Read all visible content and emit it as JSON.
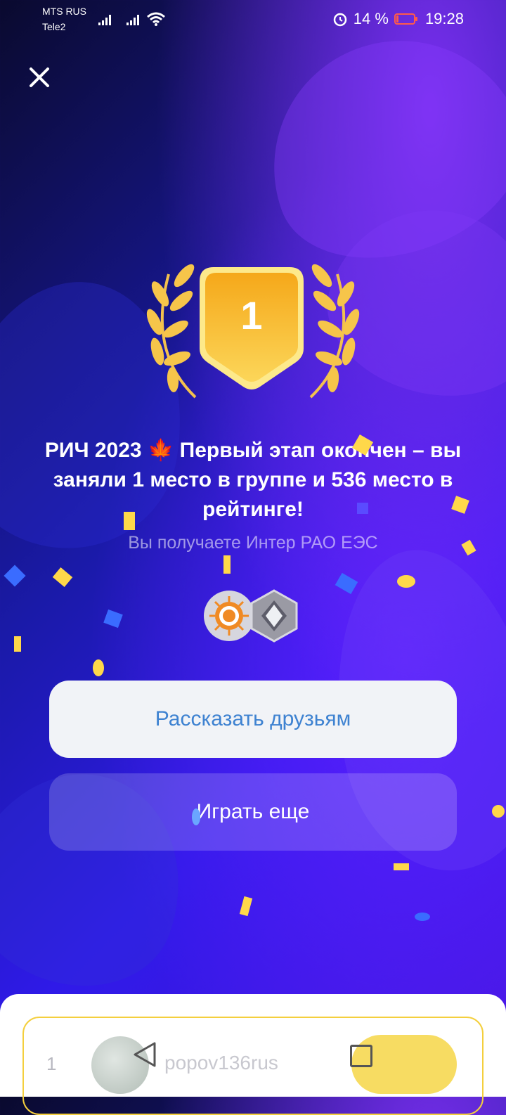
{
  "status_bar": {
    "carrier_1": "MTS RUS",
    "carrier_2": "Tele2",
    "battery_percent": "14 %",
    "battery_level": 0.14,
    "time": "19:28"
  },
  "result": {
    "place": "1",
    "headline": "РИЧ 2023 🍁 Первый этап окончен – вы заняли 1 место в группе и 536 место в рейтинге!",
    "reward_text": "Вы получаете Интер РАО ЕЭС"
  },
  "buttons": {
    "share_label": "Рассказать друзьям",
    "play_again_label": "Играть еще"
  },
  "leaderboard_row": {
    "rank": "1",
    "username": "popov136rus"
  },
  "colors": {
    "accent_gold": "#f4b81f",
    "share_text": "#3e82d1",
    "background_deep": "#1a1aa8"
  },
  "icons": {
    "close": "close-icon",
    "reward_1": "inter-rao-logo-icon",
    "reward_2": "silver-diamond-icon",
    "nav_back": "back-triangle-icon",
    "nav_recent": "recent-apps-square-icon"
  }
}
